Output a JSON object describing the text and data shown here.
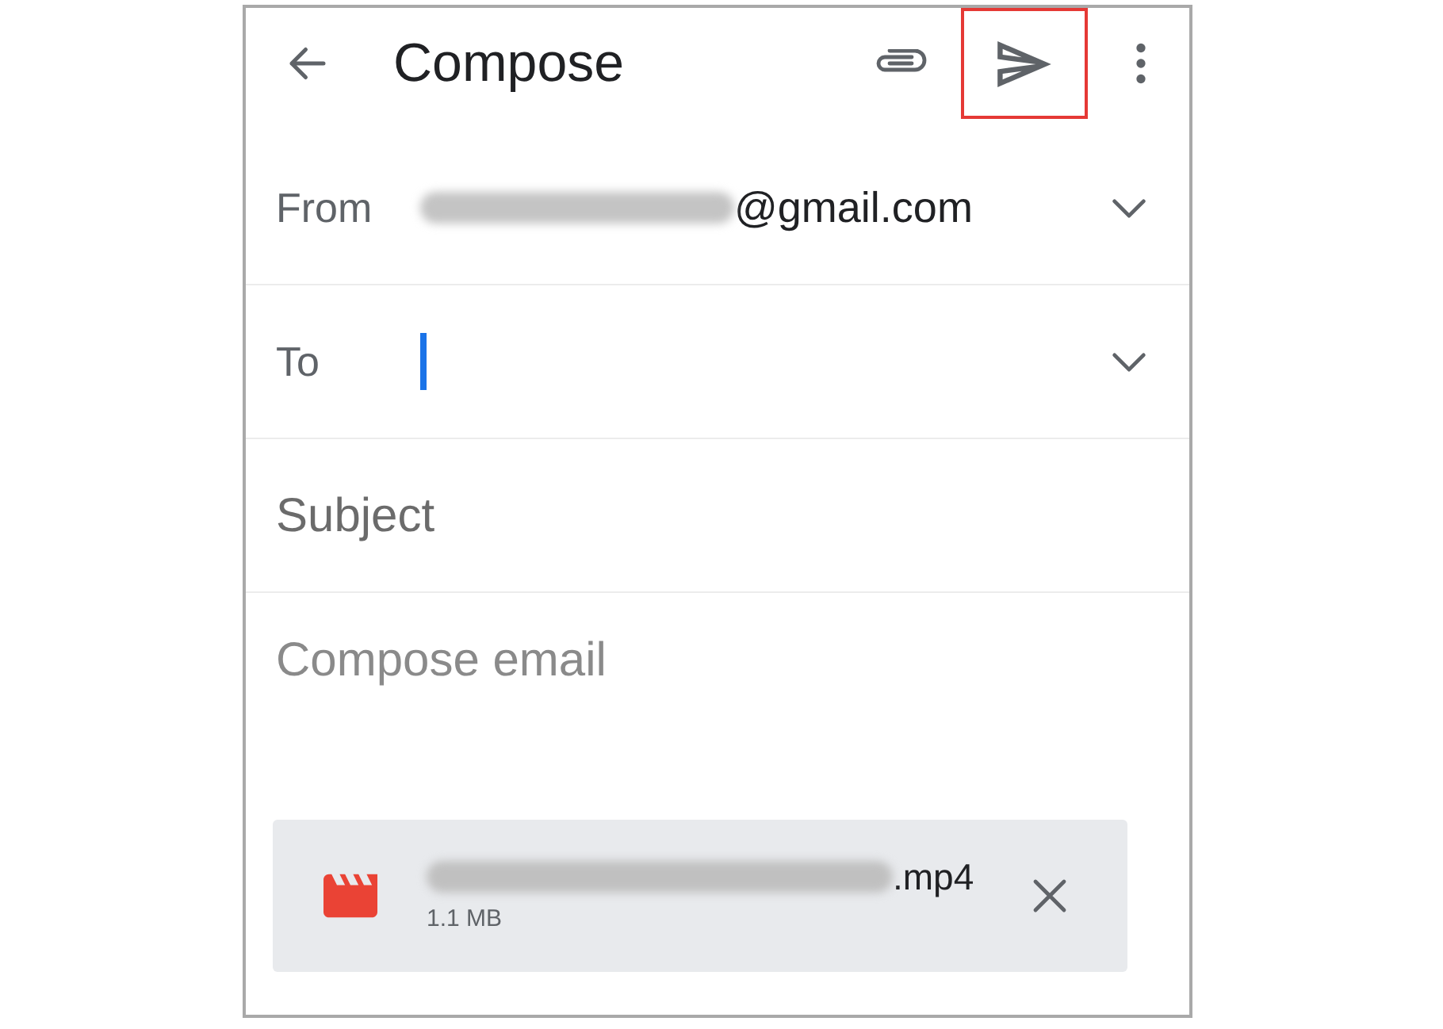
{
  "header": {
    "title": "Compose",
    "send_button": {
      "highlighted": true
    }
  },
  "fields": [
    {
      "kind": "line",
      "label": "From",
      "value": "@gmail.com",
      "redacted_prefix": true,
      "expandable": true
    },
    {
      "kind": "line",
      "label": "To",
      "expandable": true,
      "focused": true
    },
    {
      "kind": "line",
      "placeholder": "Subject"
    },
    {
      "kind": "body",
      "placeholder": "Compose email"
    }
  ],
  "attachment": {
    "name": ".mp4",
    "redacted_prefix": true,
    "size": "1.1 MB"
  }
}
